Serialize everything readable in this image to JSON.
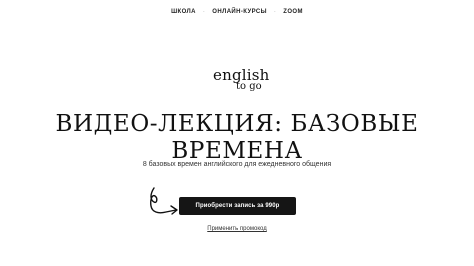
{
  "nav": {
    "items": [
      "ШКОЛА",
      "ОНЛАЙН-КУРСЫ",
      "ZOOM"
    ],
    "separator": "·"
  },
  "logo": {
    "line1": "english",
    "line2": "to go"
  },
  "hero": {
    "title_line1": "Видео-лекция: базовые",
    "title_line2": "времена",
    "subtitle": "8 базовых времен английского для ежедневного общения"
  },
  "cta": {
    "buy_label": "Приобрести запись за 990р",
    "promo_label": "Применить промокод"
  },
  "icons": {
    "arrow": "hand-drawn-arrow-icon"
  },
  "colors": {
    "button_bg": "#151515",
    "button_text": "#ffffff",
    "text": "#1a1a1a"
  }
}
